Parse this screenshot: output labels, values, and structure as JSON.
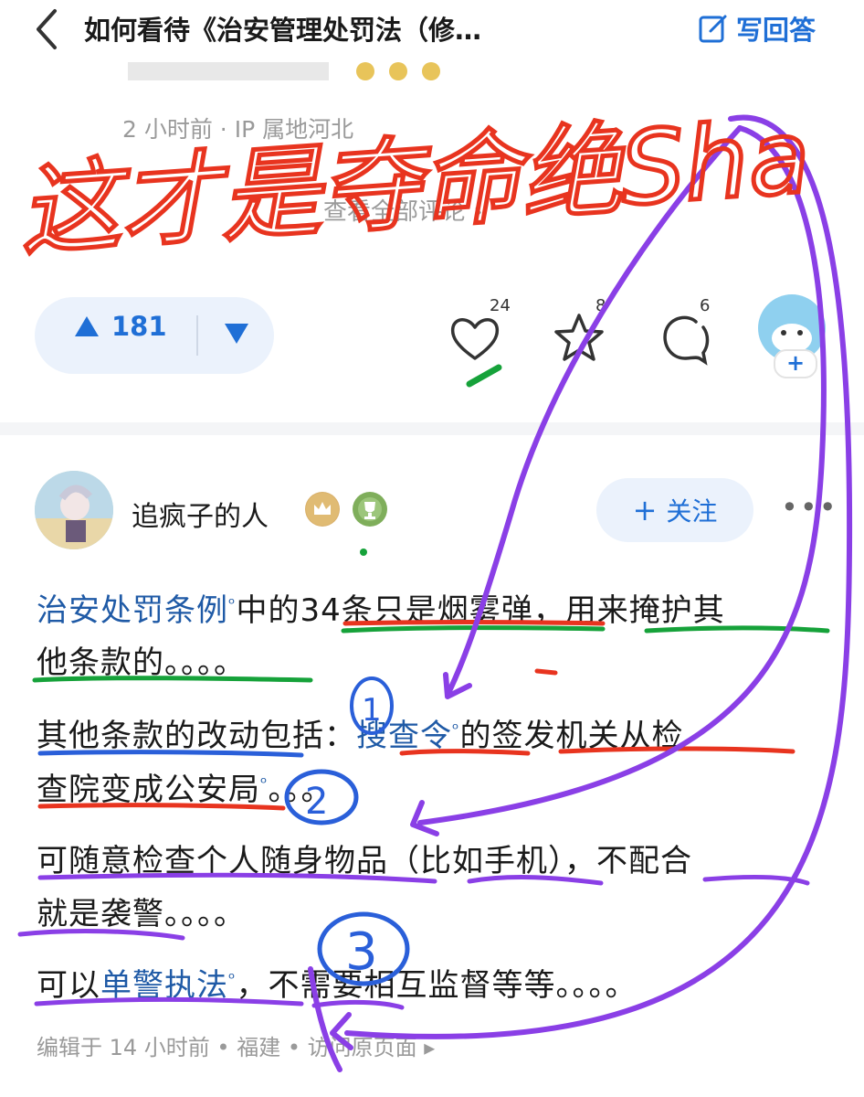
{
  "header": {
    "back_icon": "chevron-left-icon",
    "question_title": "如何看待《治安管理处罚法（修…",
    "write_answer_label": "写回答",
    "write_icon": "edit-icon"
  },
  "prev_comment": {
    "meta": "2 小时前 · IP 属地河北",
    "view_all": "查看全部评论 ›"
  },
  "actions": {
    "upvote_count": "181",
    "like_count": "24",
    "favorite_count": "8",
    "comment_count": "6",
    "add_label": "+"
  },
  "answer": {
    "author_name": "追疯子的人",
    "follow_label": "关注",
    "follow_plus": "+",
    "more": "•••",
    "p1_kw": "治安处罚条例",
    "p1_rest": "中的34条只是烟雾弹，用来掩护其",
    "p1_line2": "他条款的。。。。",
    "p2_a": "其他条款的改动包括：",
    "p2_kw": "搜查令",
    "p2_b": "的签发机关从检",
    "p2_line2": "查院变成公安局",
    "p2_line2_tail": "。。。",
    "p3_line1": "可随意检查个人随身物品（比如手机），不配合",
    "p3_line2": "就是袭警。。。。",
    "p4_a": "可以",
    "p4_kw": "单警执法",
    "p4_b": "，不需要相互监督等等。。。。",
    "footer": "编辑于 14 小时前 • 福建 • 访问原页面 ▸"
  },
  "annotation": {
    "red_text": "这才是夺命绝Sha",
    "circle_1": "1",
    "circle_2": "2",
    "circle_3": "3"
  },
  "colors": {
    "accent": "#1f6fd6",
    "red_pen": "#e8341f",
    "purple_pen": "#8a3fe6",
    "green_pen": "#16a23a",
    "blue_pen": "#2a5fd9"
  }
}
